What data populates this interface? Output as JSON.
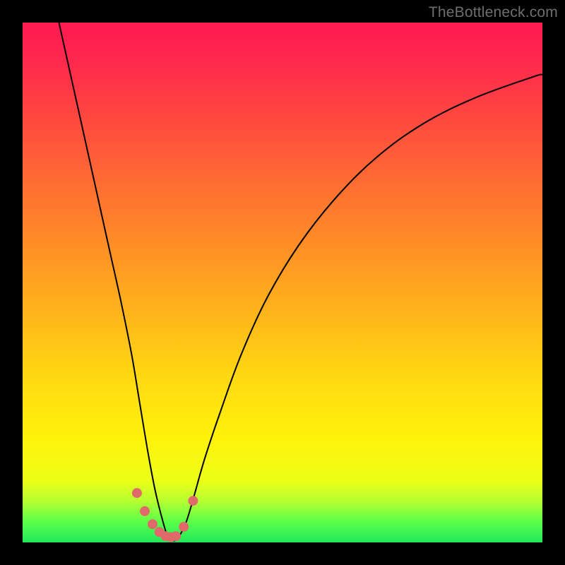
{
  "watermark": "TheBottleneck.com",
  "chart_data": {
    "type": "line",
    "title": "",
    "xlabel": "",
    "ylabel": "",
    "xlim": [
      0,
      100
    ],
    "ylim": [
      0,
      100
    ],
    "series": [
      {
        "name": "curve",
        "x": [
          7,
          9,
          11,
          13,
          15,
          17,
          19,
          21,
          22.5,
          24,
          25.5,
          27,
          28,
          29,
          30,
          31.5,
          33,
          35,
          38,
          42,
          47,
          53,
          60,
          68,
          77,
          87,
          98,
          100
        ],
        "values": [
          100,
          91,
          82,
          73,
          64,
          55,
          46,
          36,
          27,
          18,
          10,
          4,
          1,
          0.3,
          1,
          4,
          9,
          16,
          25,
          36,
          47,
          57,
          66,
          74,
          80.5,
          85.5,
          89.5,
          90
        ]
      },
      {
        "name": "dots",
        "x": [
          22.0,
          23.5,
          25.0,
          26.3,
          27.5,
          28.5,
          29.5,
          31.0,
          32.8
        ],
        "values": [
          9.5,
          6.0,
          3.5,
          2.0,
          1.2,
          1.0,
          1.2,
          3.0,
          8.0
        ]
      }
    ],
    "marker_color": "#e06a6a",
    "curve_color": "#000000",
    "background_gradient": [
      "#ff1a50",
      "#ffd812",
      "#22e85e"
    ]
  }
}
